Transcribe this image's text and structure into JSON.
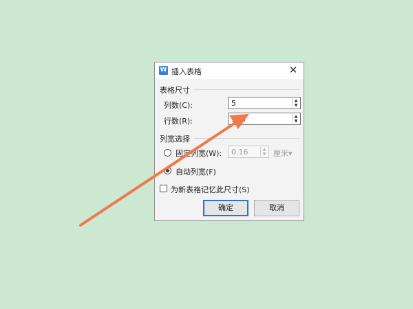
{
  "dialog": {
    "title": "插入表格",
    "app_icon_glyph": "W",
    "close_glyph": "✕"
  },
  "table_size": {
    "group_title": "表格尺寸",
    "columns_label": "列数(C):",
    "columns_value": "5",
    "rows_label": "行数(R):",
    "rows_value": "100"
  },
  "column_width": {
    "group_title": "列宽选择",
    "fixed_label": "固定列宽(W):",
    "fixed_value": "0.16",
    "unit": "厘米▾",
    "auto_label": "自动列宽(F)",
    "selected": "auto"
  },
  "remember_label": "为新表格记忆此尺寸(S)",
  "buttons": {
    "ok": "确定",
    "cancel": "取消"
  },
  "spin_glyphs": {
    "up": "▲",
    "down": "▼"
  },
  "colors": {
    "background": "#cde8d1",
    "annotation_arrow": "#f0784a",
    "accent": "#2f72c7"
  }
}
